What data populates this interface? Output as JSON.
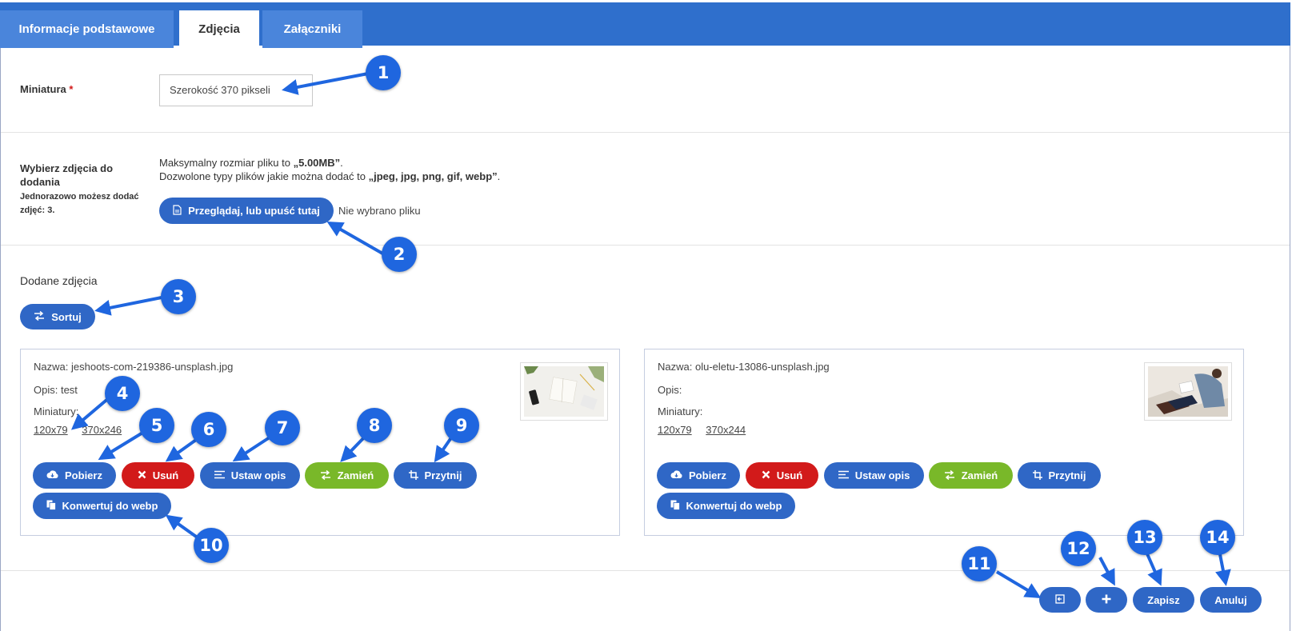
{
  "tabs": [
    {
      "label": "Informacje podstawowe",
      "active": false
    },
    {
      "label": "Zdjęcia",
      "active": true
    },
    {
      "label": "Załączniki",
      "active": false
    }
  ],
  "miniatura": {
    "label": "Miniatura",
    "required_mark": "*",
    "value": "Szerokość 370 pikseli"
  },
  "upload": {
    "label_line1": "Wybierz zdjęcia do",
    "label_line2": "dodania",
    "hint_prefix": "Jednorazowo możesz dodać",
    "hint_suffix": "zdjęć:",
    "hint_count": "3.",
    "max_size_prefix": "Maksymalny rozmiar pliku to ",
    "max_size_value": "„5.00MB”",
    "max_size_suffix": ".",
    "types_prefix": "Dozwolone typy plików jakie można dodać to ",
    "types_value": "„jpeg, jpg, png, gif, webp”",
    "types_suffix": ".",
    "browse_label": "Przeglądaj, lub upuść tutaj",
    "no_file": "Nie wybrano pliku"
  },
  "added": {
    "title": "Dodane zdjęcia",
    "sort_label": "Sortuj"
  },
  "photos": [
    {
      "name_label": "Nazwa:",
      "name": "jeshoots-com-219386-unsplash.jpg",
      "desc_label": "Opis:",
      "desc": "test",
      "thumbs_label": "Miniatury:",
      "thumbs": [
        "120x79",
        "370x246"
      ]
    },
    {
      "name_label": "Nazwa:",
      "name": "olu-eletu-13086-unsplash.jpg",
      "desc_label": "Opis:",
      "desc": "",
      "thumbs_label": "Miniatury:",
      "thumbs": [
        "120x79",
        "370x244"
      ]
    }
  ],
  "photo_actions": {
    "download": "Pobierz",
    "delete": "Usuń",
    "set_desc": "Ustaw opis",
    "replace": "Zamień",
    "crop": "Przytnij",
    "convert": "Konwertuj do webp"
  },
  "footer": {
    "save": "Zapisz",
    "cancel": "Anuluj"
  },
  "callouts": [
    "1",
    "2",
    "3",
    "4",
    "5",
    "6",
    "7",
    "8",
    "9",
    "10",
    "11",
    "12",
    "13",
    "14"
  ],
  "colors": {
    "header": "#2f6fcc",
    "button_blue": "#2f67c6",
    "button_red": "#d21a1a",
    "button_green": "#79b829",
    "callout": "#1f66df"
  },
  "icons": {
    "browse": "file-icon",
    "sort": "swap-arrows-icon",
    "download": "cloud-download-icon",
    "delete": "x-icon",
    "set_desc": "text-lines-icon",
    "replace": "swap-arrows-icon",
    "crop": "crop-icon",
    "convert": "copy-icon",
    "back": "back-icon",
    "add": "plus-icon"
  }
}
